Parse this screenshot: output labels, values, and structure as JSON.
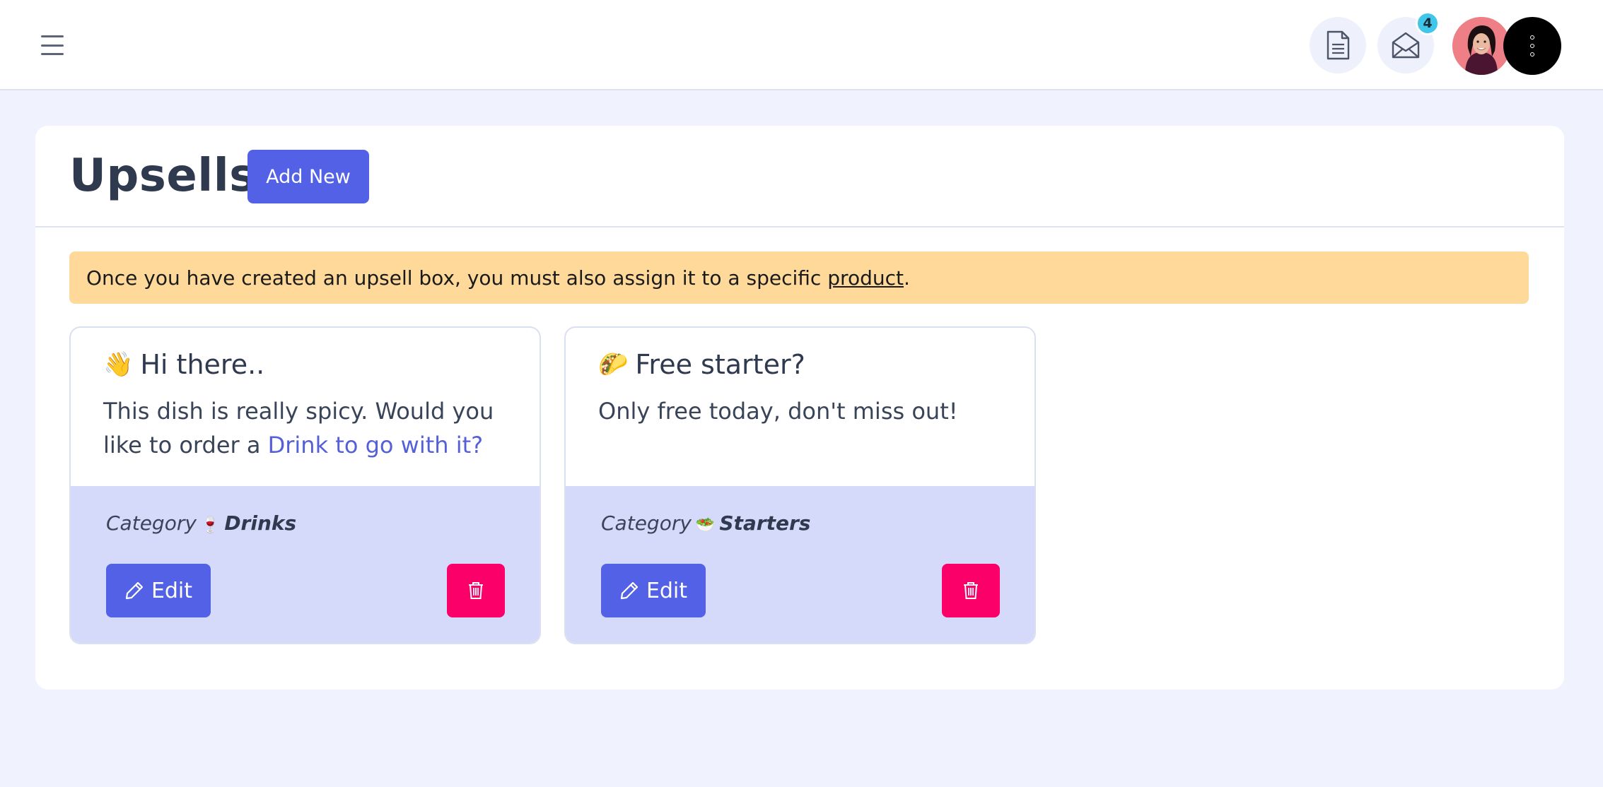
{
  "topbar": {
    "menu_icon": "hamburger-icon",
    "document_icon": "document-icon",
    "mail_icon": "envelope-open-icon",
    "mail_badge": "4",
    "more_icon": "vertical-dots-icon"
  },
  "page": {
    "title": "Upsells",
    "add_new_label": "Add New"
  },
  "notice": {
    "text_before": "Once you have created an upsell box, you must also assign it to a specific",
    "link": "product",
    "text_after": "."
  },
  "cards": [
    {
      "emoji": "👋",
      "title": "Hi there..",
      "text_before": "This dish is really spicy. Would you like to order a",
      "text_highlight": "Drink to go with it?",
      "category_label": "Category",
      "category_icon": "🍷",
      "category_name": "Drinks",
      "edit_label": "Edit"
    },
    {
      "emoji": "🌮",
      "title": "Free starter?",
      "text_before": "Only free today, don't miss out!",
      "text_highlight": "",
      "category_label": "Category",
      "category_icon": "🥗",
      "category_name": "Starters",
      "edit_label": "Edit"
    }
  ],
  "colors": {
    "accent": "#5361e6",
    "danger": "#fa0068",
    "notice_bg": "#fed999",
    "card_footer_bg": "#d5d9fa",
    "page_bg": "#f0f3fd",
    "badge": "#3fc6e8"
  }
}
